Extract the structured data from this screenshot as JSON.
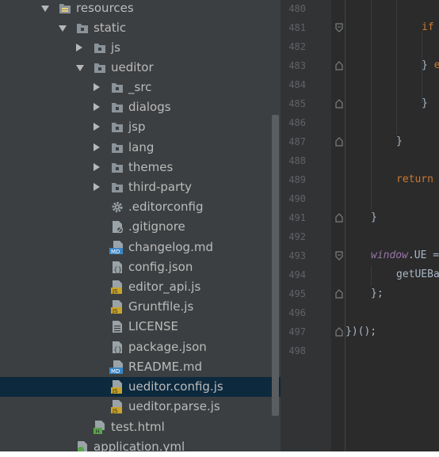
{
  "tree": {
    "items": [
      {
        "label": "resources",
        "type": "folder-resources",
        "expanded": true
      },
      {
        "label": "static",
        "type": "folder",
        "expanded": true
      },
      {
        "label": "js",
        "type": "folder",
        "expanded": false
      },
      {
        "label": "ueditor",
        "type": "folder",
        "expanded": true
      },
      {
        "label": "_src",
        "type": "folder",
        "expanded": false
      },
      {
        "label": "dialogs",
        "type": "folder",
        "expanded": false
      },
      {
        "label": "jsp",
        "type": "folder",
        "expanded": false
      },
      {
        "label": "lang",
        "type": "folder",
        "expanded": false
      },
      {
        "label": "themes",
        "type": "folder",
        "expanded": false
      },
      {
        "label": "third-party",
        "type": "folder",
        "expanded": false
      },
      {
        "label": ".editorconfig",
        "type": "gear-file"
      },
      {
        "label": ".gitignore",
        "type": "ignore-file"
      },
      {
        "label": "changelog.md",
        "type": "md-file",
        "badge": "MD"
      },
      {
        "label": "config.json",
        "type": "json-file"
      },
      {
        "label": "editor_api.js",
        "type": "js-file",
        "badge": "JS"
      },
      {
        "label": "Gruntfile.js",
        "type": "js-file",
        "badge": "JS"
      },
      {
        "label": "LICENSE",
        "type": "text-file"
      },
      {
        "label": "package.json",
        "type": "json-file"
      },
      {
        "label": "README.md",
        "type": "md-file",
        "badge": "MD"
      },
      {
        "label": "ueditor.config.js",
        "type": "js-file",
        "badge": "JS",
        "selected": true
      },
      {
        "label": "ueditor.parse.js",
        "type": "js-file",
        "badge": "JS"
      },
      {
        "label": "test.html",
        "type": "html-file",
        "badge": "H"
      },
      {
        "label": "application.yml",
        "type": "yml-file"
      }
    ]
  },
  "editor": {
    "line_numbers": [
      "480",
      "481",
      "482",
      "483",
      "484",
      "485",
      "486",
      "487",
      "488",
      "489",
      "490",
      "491",
      "492",
      "493",
      "494",
      "495",
      "496",
      "497",
      "498"
    ],
    "code": {
      "l481": "if",
      "l483_brace": "}",
      "l483_kw": " e",
      "l485": "}",
      "l487": "}",
      "l489": "return",
      "l491": "}",
      "l493_kw": "window",
      "l493_rest": ".UE =",
      "l494": "getUEBa",
      "l495": "};",
      "l497": "})();"
    }
  },
  "colors": {
    "tree_bg": "#3c3f41",
    "selection": "#0d293e",
    "editor_bg": "#2b2b2b",
    "gutter_bg": "#313335",
    "keyword": "#cc7832",
    "js_badge": "#c9a42a",
    "md_badge": "#3a87c7",
    "html_badge": "#58a54b"
  }
}
